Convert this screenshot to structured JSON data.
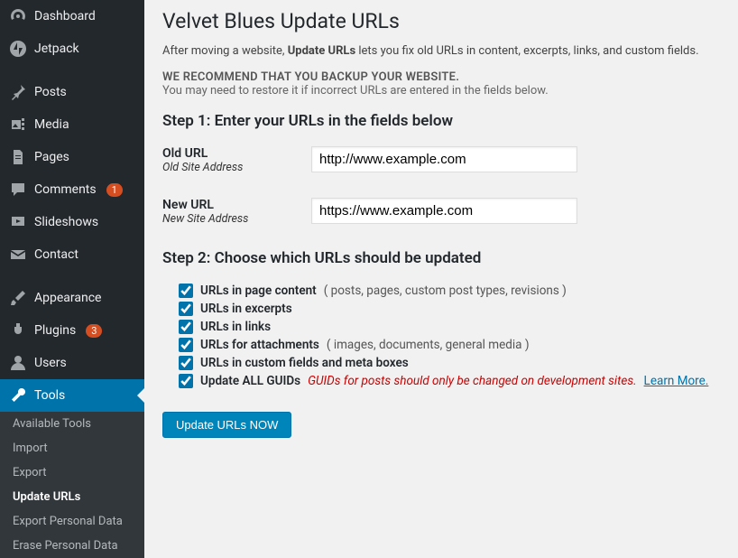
{
  "sidebar": {
    "items": [
      {
        "label": "Dashboard",
        "icon": "dashboard"
      },
      {
        "label": "Jetpack",
        "icon": "jetpack"
      },
      {
        "label": "Posts",
        "icon": "pin"
      },
      {
        "label": "Media",
        "icon": "media"
      },
      {
        "label": "Pages",
        "icon": "page"
      },
      {
        "label": "Comments",
        "icon": "comment",
        "badge": "1"
      },
      {
        "label": "Slideshows",
        "icon": "slideshow"
      },
      {
        "label": "Contact",
        "icon": "mail"
      },
      {
        "label": "Appearance",
        "icon": "brush"
      },
      {
        "label": "Plugins",
        "icon": "plug",
        "badge": "3"
      },
      {
        "label": "Users",
        "icon": "user"
      },
      {
        "label": "Tools",
        "icon": "wrench",
        "active": true
      }
    ],
    "sub": [
      {
        "label": "Available Tools"
      },
      {
        "label": "Import"
      },
      {
        "label": "Export"
      },
      {
        "label": "Update URLs",
        "active": true
      },
      {
        "label": "Export Personal Data"
      },
      {
        "label": "Erase Personal Data"
      }
    ]
  },
  "page": {
    "title": "Velvet Blues Update URLs",
    "intro_before": "After moving a website, ",
    "intro_strong": "Update URLs",
    "intro_after": " lets you fix old URLs in content, excerpts, links, and custom fields.",
    "backup_warn": "WE RECOMMEND THAT YOU BACKUP YOUR WEBSITE.",
    "backup_sub": "You may need to restore it if incorrect URLs are entered in the fields below.",
    "step1_heading": "Step 1: Enter your URLs in the fields below",
    "old_url_label": "Old URL",
    "old_url_sub": "Old Site Address",
    "old_url_value": "http://www.example.com",
    "new_url_label": "New URL",
    "new_url_sub": "New Site Address",
    "new_url_value": "https://www.example.com",
    "step2_heading": "Step 2: Choose which URLs should be updated",
    "checks": [
      {
        "label": "URLs in page content",
        "desc": "( posts, pages, custom post types, revisions )"
      },
      {
        "label": "URLs in excerpts",
        "desc": ""
      },
      {
        "label": "URLs in links",
        "desc": ""
      },
      {
        "label": "URLs for attachments",
        "desc": "( images, documents, general media )"
      },
      {
        "label": "URLs in custom fields and meta boxes",
        "desc": ""
      }
    ],
    "guid_label": "Update ALL GUIDs",
    "guid_warn": "GUIDs for posts should only be changed on development sites.",
    "learn_more": "Learn More.",
    "submit": "Update URLs NOW"
  }
}
